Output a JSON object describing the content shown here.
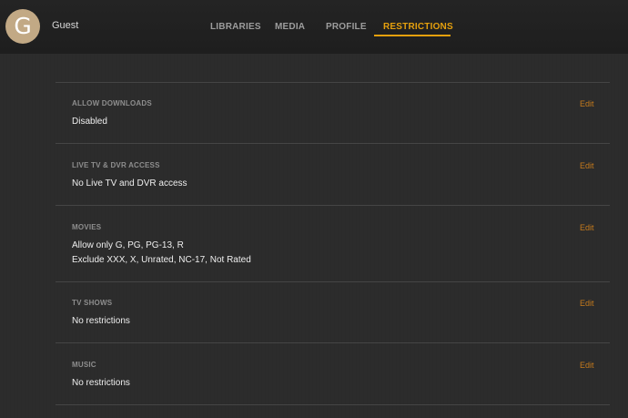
{
  "user": {
    "avatar_letter": "G",
    "name": "Guest"
  },
  "tabs": [
    {
      "label": "LIBRARIES"
    },
    {
      "label": "MEDIA"
    },
    {
      "label": "PROFILE"
    },
    {
      "label": "RESTRICTIONS",
      "active": true
    }
  ],
  "colors": {
    "accent": "#e5a00d",
    "edit_link": "#c57a1c"
  },
  "sections": [
    {
      "title": "ALLOW DOWNLOADS",
      "values": [
        "Disabled"
      ],
      "edit_label": "Edit"
    },
    {
      "title": "LIVE TV & DVR ACCESS",
      "values": [
        "No Live TV and DVR access"
      ],
      "edit_label": "Edit"
    },
    {
      "title": "MOVIES",
      "values": [
        "Allow only G, PG, PG-13, R",
        "Exclude XXX, X, Unrated, NC-17, Not Rated"
      ],
      "edit_label": "Edit"
    },
    {
      "title": "TV SHOWS",
      "values": [
        "No restrictions"
      ],
      "edit_label": "Edit"
    },
    {
      "title": "MUSIC",
      "values": [
        "No restrictions"
      ],
      "edit_label": "Edit"
    }
  ]
}
